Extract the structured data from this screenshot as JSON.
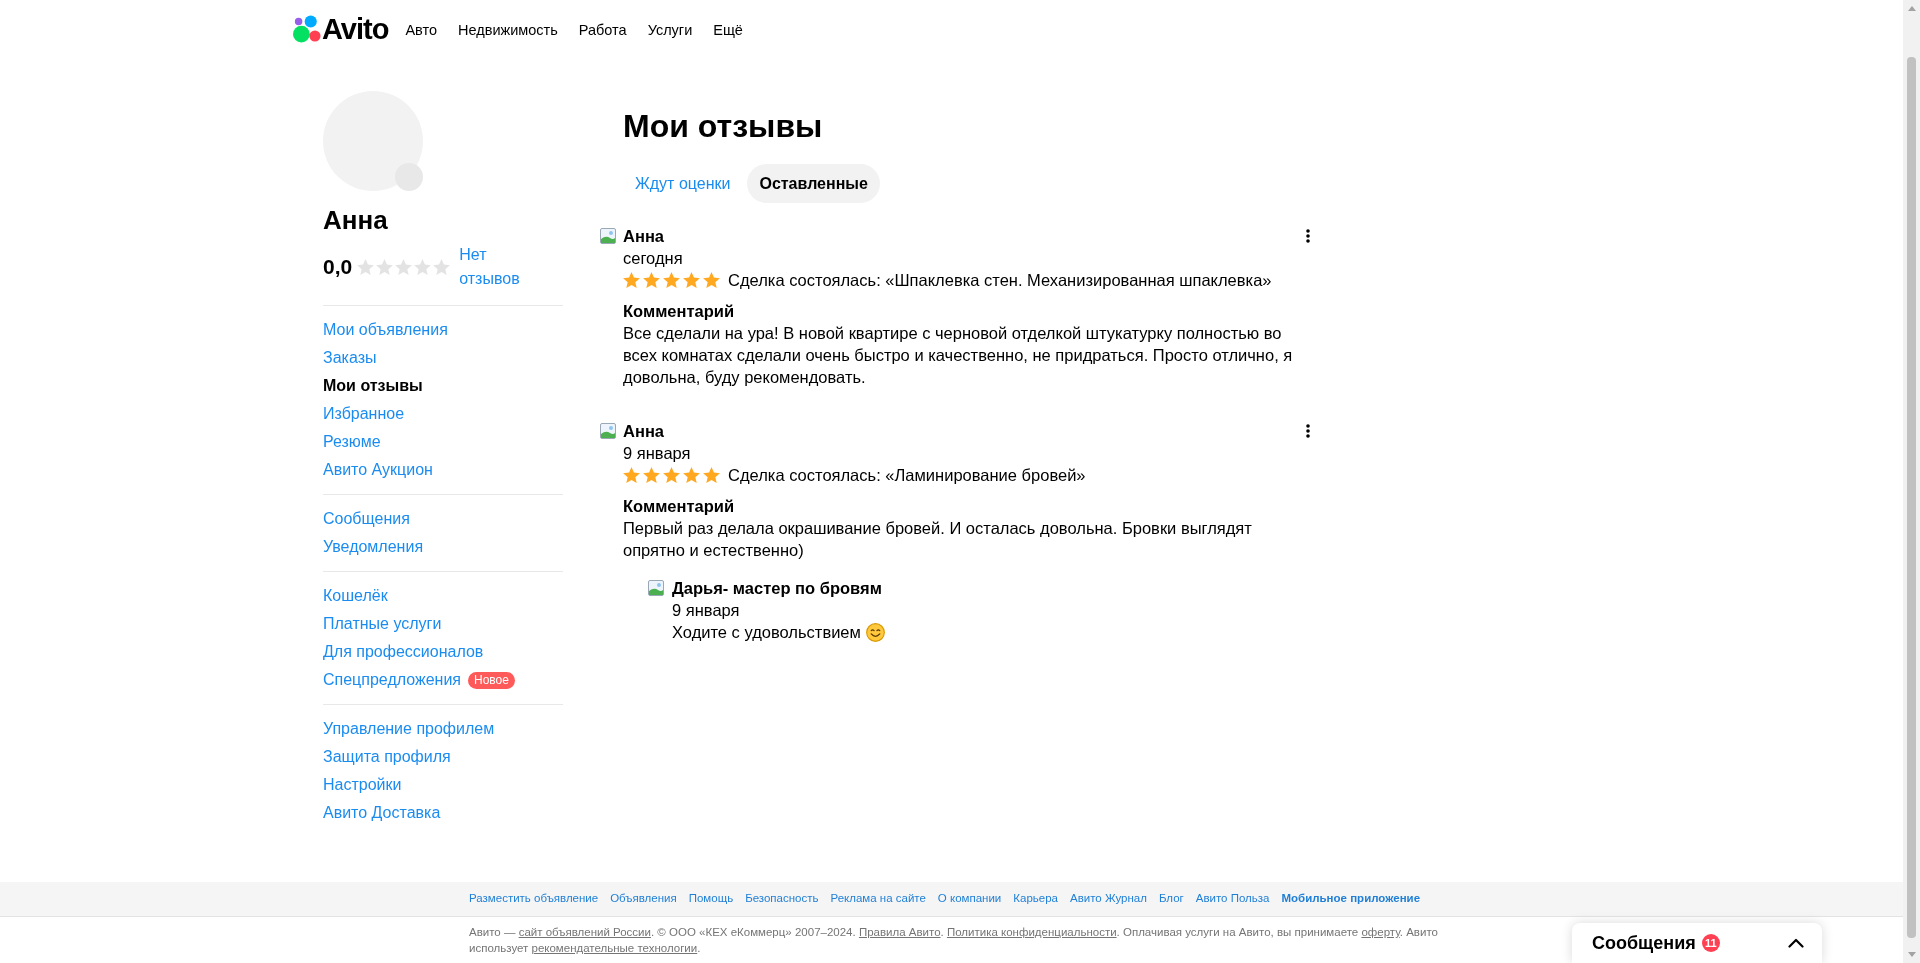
{
  "header": {
    "logo": "Avito",
    "nav": [
      "Авто",
      "Недвижимость",
      "Работа",
      "Услуги",
      "Ещё"
    ]
  },
  "profile": {
    "name": "Анна",
    "rating": "0,0",
    "stars": 0,
    "reviews_link": "Нет отзывов"
  },
  "sidebar": {
    "groups": [
      {
        "items": [
          {
            "label": "Мои объявления",
            "selected": false
          },
          {
            "label": "Заказы",
            "selected": false
          },
          {
            "label": "Мои отзывы",
            "selected": true
          },
          {
            "label": "Избранное",
            "selected": false
          },
          {
            "label": "Резюме",
            "selected": false
          },
          {
            "label": "Авито Аукцион",
            "selected": false
          }
        ]
      },
      {
        "items": [
          {
            "label": "Сообщения",
            "selected": false
          },
          {
            "label": "Уведомления",
            "selected": false
          }
        ]
      },
      {
        "items": [
          {
            "label": "Кошелёк",
            "selected": false
          },
          {
            "label": "Платные услуги",
            "selected": false
          },
          {
            "label": "Для профессионалов",
            "selected": false
          },
          {
            "label": "Спецпредложения",
            "selected": false,
            "badge": "Новое"
          }
        ]
      },
      {
        "items": [
          {
            "label": "Управление профилем",
            "selected": false
          },
          {
            "label": "Защита профиля",
            "selected": false
          },
          {
            "label": "Настройки",
            "selected": false
          },
          {
            "label": "Авито Доставка",
            "selected": false
          }
        ]
      }
    ]
  },
  "page": {
    "title": "Мои отзывы",
    "tabs": [
      {
        "label": "Ждут оценки",
        "selected": false
      },
      {
        "label": "Оставленные",
        "selected": true
      }
    ]
  },
  "reviews": [
    {
      "author": "Анна",
      "date": "сегодня",
      "stars": 5,
      "deal": "Сделка состоялась: «Шпаклевка стен. Механизированная шпаклевка»",
      "comment_label": "Комментарий",
      "comment": "Все сделали на ура! В новой квартире с черновой отделкой штукатурку полностью во всех комнатах сделали очень быстро и качественно, не придраться. Просто отлично, я довольна, буду рекомендовать."
    },
    {
      "author": "Анна",
      "date": "9 января",
      "stars": 5,
      "deal": "Сделка состоялась: «Ламинирование бровей»",
      "comment_label": "Комментарий",
      "comment": "Первый раз делала окрашивание бровей. И осталась довольна. Бровки выглядят опрятно и естественно)",
      "reply": {
        "author": "Дарья- мастер по бровям",
        "date": "9 января",
        "text": "Ходите с удовольствием"
      }
    }
  ],
  "footer": {
    "links": [
      {
        "label": "Разместить объявление",
        "highlighted": false
      },
      {
        "label": "Объявления",
        "highlighted": false
      },
      {
        "label": "Помощь",
        "highlighted": false
      },
      {
        "label": "Безопасность",
        "highlighted": false
      },
      {
        "label": "Реклама на сайте",
        "highlighted": false
      },
      {
        "label": "О компании",
        "highlighted": false
      },
      {
        "label": "Карьера",
        "highlighted": false
      },
      {
        "label": "Авито Журнал",
        "highlighted": false
      },
      {
        "label": "Блог",
        "highlighted": false
      },
      {
        "label": "Авито Польза",
        "highlighted": false
      },
      {
        "label": "Мобильное приложение",
        "highlighted": true
      }
    ],
    "copyright": [
      {
        "kind": "text",
        "text": "Авито — "
      },
      {
        "kind": "link",
        "text": "сайт объявлений России"
      },
      {
        "kind": "text",
        "text": ". © ООО «КЕХ eКоммерц» 2007–2024. "
      },
      {
        "kind": "link",
        "text": "Правила Авито"
      },
      {
        "kind": "text",
        "text": ". "
      },
      {
        "kind": "link",
        "text": "Политика конфиденциальности"
      },
      {
        "kind": "text",
        "text": ". Оплачивая услуги на Авито, вы принимаете "
      },
      {
        "kind": "link",
        "text": "оферту"
      },
      {
        "kind": "text",
        "text": ". Авито использует "
      },
      {
        "kind": "link",
        "text": "рекомендательные технологии"
      },
      {
        "kind": "text",
        "text": "."
      }
    ]
  },
  "messages_widget": {
    "title": "Сообщения",
    "count": "11"
  }
}
